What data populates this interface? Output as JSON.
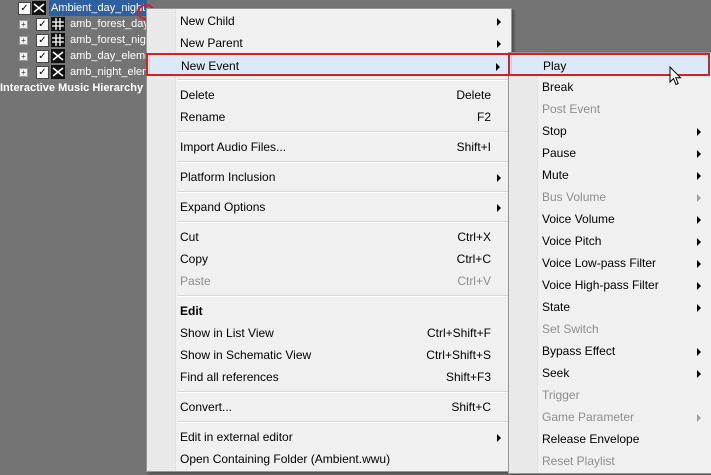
{
  "tree": {
    "root": {
      "label": "Ambient_day_night"
    },
    "children": [
      {
        "label": "amb_forest_day",
        "icon": "grid-icon"
      },
      {
        "label": "amb_forest_night",
        "icon": "grid-icon"
      },
      {
        "label": "amb_day_elements",
        "icon": "random-icon"
      },
      {
        "label": "amb_night_elements",
        "icon": "random-icon"
      }
    ],
    "section_title": "Interactive Music Hierarchy",
    "check_glyph": "✓",
    "expander_glyph": "+"
  },
  "context_menu": {
    "items": [
      {
        "label": "New Child",
        "shortcut": "",
        "submenu": true
      },
      {
        "label": "New Parent",
        "shortcut": "",
        "submenu": true
      },
      {
        "label": "New Event",
        "shortcut": "",
        "submenu": true,
        "highlighted": true
      },
      {
        "separator": true
      },
      {
        "label": "Delete",
        "shortcut": "Delete"
      },
      {
        "label": "Rename",
        "shortcut": "F2"
      },
      {
        "separator": true
      },
      {
        "label": "Import Audio Files...",
        "shortcut": "Shift+I"
      },
      {
        "separator": true
      },
      {
        "label": "Platform Inclusion",
        "shortcut": "",
        "submenu": true
      },
      {
        "separator": true
      },
      {
        "label": "Expand Options",
        "shortcut": "",
        "submenu": true
      },
      {
        "separator": true
      },
      {
        "label": "Cut",
        "shortcut": "Ctrl+X"
      },
      {
        "label": "Copy",
        "shortcut": "Ctrl+C"
      },
      {
        "label": "Paste",
        "shortcut": "Ctrl+V",
        "disabled": true
      },
      {
        "separator": true
      },
      {
        "label": "Edit",
        "shortcut": "",
        "bold": true
      },
      {
        "label": "Show in List View",
        "shortcut": "Ctrl+Shift+F"
      },
      {
        "label": "Show in Schematic View",
        "shortcut": "Ctrl+Shift+S"
      },
      {
        "label": "Find all references",
        "shortcut": "Shift+F3"
      },
      {
        "separator": true
      },
      {
        "label": "Convert...",
        "shortcut": "Shift+C"
      },
      {
        "separator": true
      },
      {
        "label": "Edit in external editor",
        "shortcut": "",
        "submenu": true
      },
      {
        "label": "Open Containing Folder (Ambient.wwu)",
        "shortcut": ""
      }
    ]
  },
  "event_submenu": {
    "items": [
      {
        "label": "Play",
        "highlighted": true
      },
      {
        "label": "Break"
      },
      {
        "label": "Post Event",
        "disabled": true
      },
      {
        "label": "Stop",
        "submenu": true
      },
      {
        "label": "Pause",
        "submenu": true
      },
      {
        "label": "Mute",
        "submenu": true
      },
      {
        "label": "Bus Volume",
        "submenu": true,
        "disabled": true
      },
      {
        "label": "Voice Volume",
        "submenu": true
      },
      {
        "label": "Voice Pitch",
        "submenu": true
      },
      {
        "label": "Voice Low-pass Filter",
        "submenu": true
      },
      {
        "label": "Voice High-pass Filter",
        "submenu": true
      },
      {
        "label": "State",
        "submenu": true
      },
      {
        "label": "Set Switch",
        "disabled": true
      },
      {
        "label": "Bypass Effect",
        "submenu": true
      },
      {
        "label": "Seek",
        "submenu": true
      },
      {
        "label": "Trigger",
        "disabled": true
      },
      {
        "label": "Game Parameter",
        "submenu": true,
        "disabled": true
      },
      {
        "label": "Release Envelope"
      },
      {
        "label": "Reset Playlist",
        "disabled": true
      }
    ]
  },
  "colors": {
    "highlight_box": "#d62020",
    "hover_bg": "#dbe9f8",
    "disabled_text": "#8d8d8d"
  }
}
